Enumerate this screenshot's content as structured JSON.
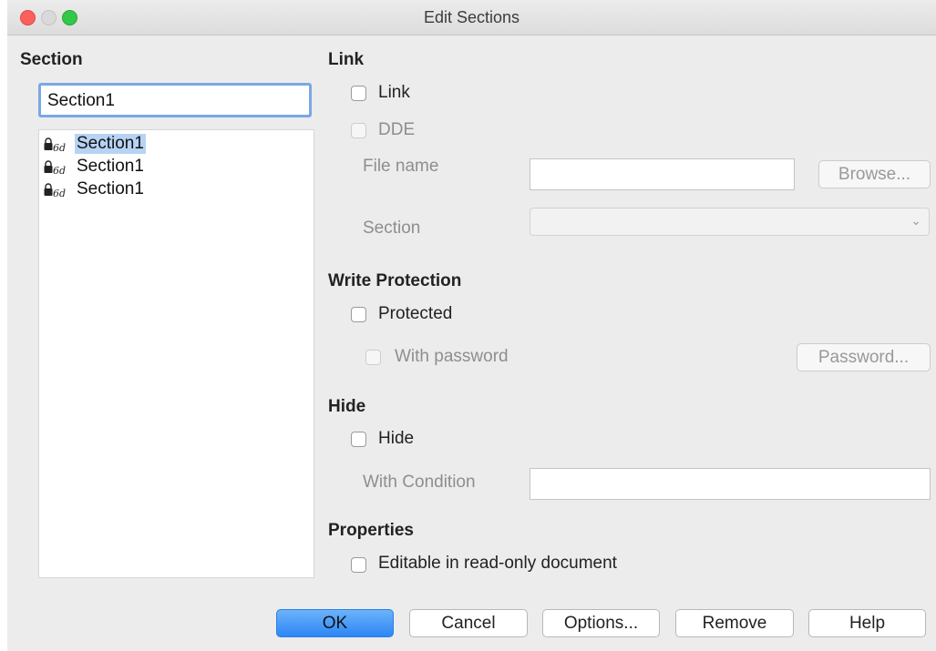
{
  "window": {
    "title": "Edit Sections"
  },
  "left": {
    "heading": "Section",
    "name_value": "Section1",
    "sections": [
      {
        "label": "Section1",
        "selected": true
      },
      {
        "label": "Section1",
        "selected": false
      },
      {
        "label": "Section1",
        "selected": false
      }
    ]
  },
  "link": {
    "heading": "Link",
    "link_label": "Link",
    "dde_label": "DDE",
    "file_name_label": "File name",
    "browse_label": "Browse...",
    "section_label": "Section"
  },
  "write_protection": {
    "heading": "Write Protection",
    "protected_label": "Protected",
    "with_password_label": "With password",
    "password_button": "Password..."
  },
  "hide": {
    "heading": "Hide",
    "hide_label": "Hide",
    "condition_label": "With Condition"
  },
  "properties": {
    "heading": "Properties",
    "editable_label": "Editable in read-only document"
  },
  "buttons": {
    "ok": "OK",
    "cancel": "Cancel",
    "options": "Options...",
    "remove": "Remove",
    "help": "Help"
  },
  "colors": {
    "accent": "#2c86f5",
    "selection": "#b7d3f4",
    "close": "#fc605c",
    "zoom": "#34c84a"
  },
  "icons": {
    "section_item": "lock-link-icon",
    "dropdown": "chevron-down-icon"
  }
}
